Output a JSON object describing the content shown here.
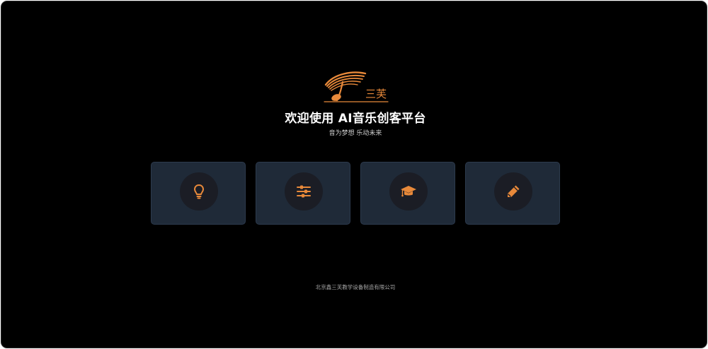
{
  "brand": {
    "logo_text": "三芙"
  },
  "hero": {
    "title": "欢迎使用 AI音乐创客平台",
    "subtitle": "音为梦想 乐动未来"
  },
  "cards": [
    {
      "icon": "lightbulb-icon"
    },
    {
      "icon": "sliders-icon"
    },
    {
      "icon": "graduation-cap-icon"
    },
    {
      "icon": "pencil-icon"
    }
  ],
  "footer": {
    "company": "北京鑫三芙教学设备制造有限公司"
  },
  "colors": {
    "accent": "#e8893a",
    "background": "#000000",
    "card": "#1f2a38",
    "icon_circle": "#1b1d25"
  }
}
